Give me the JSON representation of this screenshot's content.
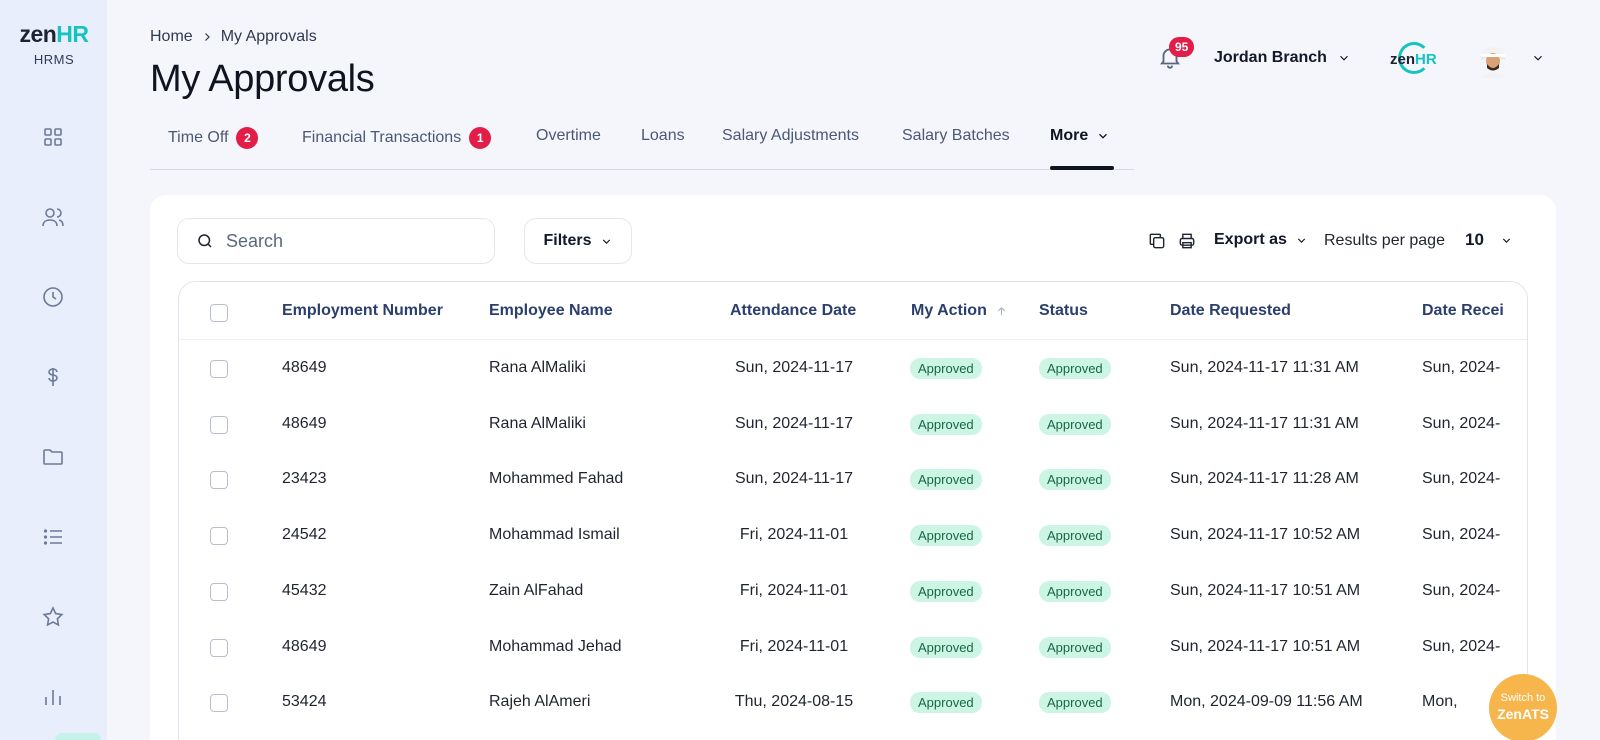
{
  "app": {
    "logo_zen": "zen",
    "logo_hr": "HR",
    "logo_sub": "HRMS"
  },
  "sidebar": {
    "icons": [
      "grid-icon",
      "users-icon",
      "clock-icon",
      "dollar-icon",
      "folder-icon",
      "list-icon",
      "star-icon",
      "bar-chart-icon"
    ]
  },
  "breadcrumb": {
    "home": "Home",
    "separator": ">",
    "current": "My Approvals"
  },
  "page": {
    "title": "My Approvals"
  },
  "header": {
    "notification_count": "95",
    "branch": "Jordan Branch",
    "brand_zen": "zen",
    "brand_hr": "HR"
  },
  "tabs": [
    {
      "label": "Time Off",
      "count": "2"
    },
    {
      "label": "Financial Transactions",
      "count": "1"
    },
    {
      "label": "Overtime"
    },
    {
      "label": "Loans"
    },
    {
      "label": "Salary Adjustments"
    },
    {
      "label": "Salary Batches"
    },
    {
      "label": "More",
      "active": true
    }
  ],
  "toolbar": {
    "search_placeholder": "Search",
    "filters_label": "Filters",
    "export_label": "Export as",
    "results_per_page_label": "Results per page",
    "results_per_page_value": "10"
  },
  "table": {
    "columns": [
      "Employment Number",
      "Employee Name",
      "Attendance Date",
      "My Action",
      "Status",
      "Date Requested",
      "Date Recei"
    ],
    "rows": [
      {
        "number": "48649",
        "name": "Rana AlMaliki",
        "attendance": "Sun, 2024-11-17",
        "action": "Approved",
        "status": "Approved",
        "requested": "Sun, 2024-11-17 11:31 AM",
        "received": "Sun, 2024-"
      },
      {
        "number": "48649",
        "name": "Rana AlMaliki",
        "attendance": "Sun, 2024-11-17",
        "action": "Approved",
        "status": "Approved",
        "requested": "Sun, 2024-11-17 11:31 AM",
        "received": "Sun, 2024-"
      },
      {
        "number": "23423",
        "name": "Mohammed Fahad",
        "attendance": "Sun, 2024-11-17",
        "action": "Approved",
        "status": "Approved",
        "requested": "Sun, 2024-11-17 11:28 AM",
        "received": "Sun, 2024-"
      },
      {
        "number": "24542",
        "name": "Mohammad Ismail",
        "attendance": "Fri, 2024-11-01",
        "action": "Approved",
        "status": "Approved",
        "requested": "Sun, 2024-11-17 10:52 AM",
        "received": "Sun, 2024-"
      },
      {
        "number": "45432",
        "name": "Zain AlFahad",
        "attendance": "Fri, 2024-11-01",
        "action": "Approved",
        "status": "Approved",
        "requested": "Sun, 2024-11-17 10:51 AM",
        "received": "Sun, 2024-"
      },
      {
        "number": "48649",
        "name": "Mohammad Jehad",
        "attendance": "Fri, 2024-11-01",
        "action": "Approved",
        "status": "Approved",
        "requested": "Sun, 2024-11-17 10:51 AM",
        "received": "Sun, 2024-"
      },
      {
        "number": "53424",
        "name": "Rajeh AlAmeri",
        "attendance": "Thu, 2024-08-15",
        "action": "Approved",
        "status": "Approved",
        "requested": "Mon, 2024-09-09 11:56 AM",
        "received": "Mon,"
      }
    ]
  },
  "switch_button": {
    "line1": "Switch to",
    "line2": "ZenATS"
  },
  "colors": {
    "accent": "#15c3c3",
    "badge": "#e11d48",
    "approved_bg": "#ccf5e6",
    "approved_text": "#166845",
    "switch_bg": "#f6b64c"
  }
}
